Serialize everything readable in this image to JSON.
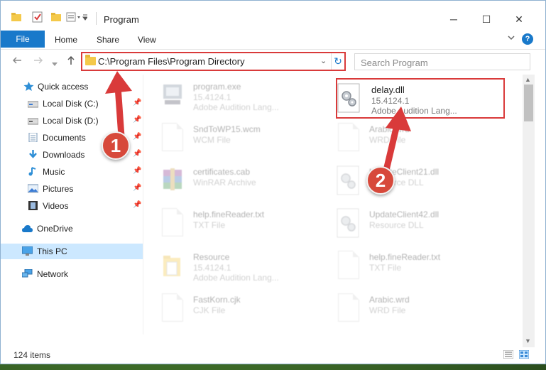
{
  "window": {
    "title": "Program",
    "controls": {
      "minimize": "─",
      "maximize": "☐",
      "close": "✕"
    }
  },
  "ribbon": {
    "tabs": [
      "File",
      "Home",
      "Share",
      "View"
    ],
    "expand_icon": "chevron-down-icon",
    "help_label": "?"
  },
  "address": {
    "path": "C:\\Program Files\\Program Directory",
    "dropdown": "⌄",
    "refresh": "↻"
  },
  "search": {
    "placeholder": "Search Program"
  },
  "nav": {
    "items": [
      {
        "label": "Quick access",
        "icon": "star-icon"
      },
      {
        "label": "Local Disk (C:)",
        "icon": "drive-icon"
      },
      {
        "label": "Local Disk (D:)",
        "icon": "drive-icon"
      },
      {
        "label": "Documents",
        "icon": "documents-icon"
      },
      {
        "label": "Downloads",
        "icon": "download-icon"
      },
      {
        "label": "Music",
        "icon": "music-icon"
      },
      {
        "label": "Pictures",
        "icon": "pictures-icon"
      },
      {
        "label": "Videos",
        "icon": "videos-icon"
      },
      {
        "label": "OneDrive",
        "icon": "cloud-icon"
      },
      {
        "label": "This PC",
        "icon": "computer-icon"
      },
      {
        "label": "Network",
        "icon": "network-icon"
      }
    ]
  },
  "files": [
    {
      "name": "program.exe",
      "line2": "15.4124.1",
      "line3": "Adobe Audition Lang..."
    },
    {
      "name": "delay.dll",
      "line2": "15.4124.1",
      "line3": "Adobe Audition Lang..."
    },
    {
      "name": "SndToWP15.wcm",
      "line2": "WCM File",
      "line3": ""
    },
    {
      "name": "Arabic.wrd",
      "line2": "WRD File",
      "line3": ""
    },
    {
      "name": "certificates.cab",
      "line2": "WinRAR Archive",
      "line3": ""
    },
    {
      "name": "UpdateClient21.dll",
      "line2": "Resource DLL",
      "line3": ""
    },
    {
      "name": "help.fineReader.txt",
      "line2": "TXT File",
      "line3": ""
    },
    {
      "name": "UpdateClient42.dll",
      "line2": "Resource DLL",
      "line3": ""
    },
    {
      "name": "Resource",
      "line2": "15.4124.1",
      "line3": "Adobe Audition Lang..."
    },
    {
      "name": "help.fineReader.txt",
      "line2": "TXT File",
      "line3": ""
    },
    {
      "name": "FastKorn.cjk",
      "line2": "CJK File",
      "line3": ""
    },
    {
      "name": "Arabic.wrd",
      "line2": "WRD File",
      "line3": ""
    }
  ],
  "status": {
    "count": "124 items"
  },
  "annotations": {
    "step1": "1",
    "step2": "2"
  },
  "colors": {
    "accent": "#1979ca",
    "annotation": "#d93a3a",
    "selected": "#cce8ff"
  }
}
